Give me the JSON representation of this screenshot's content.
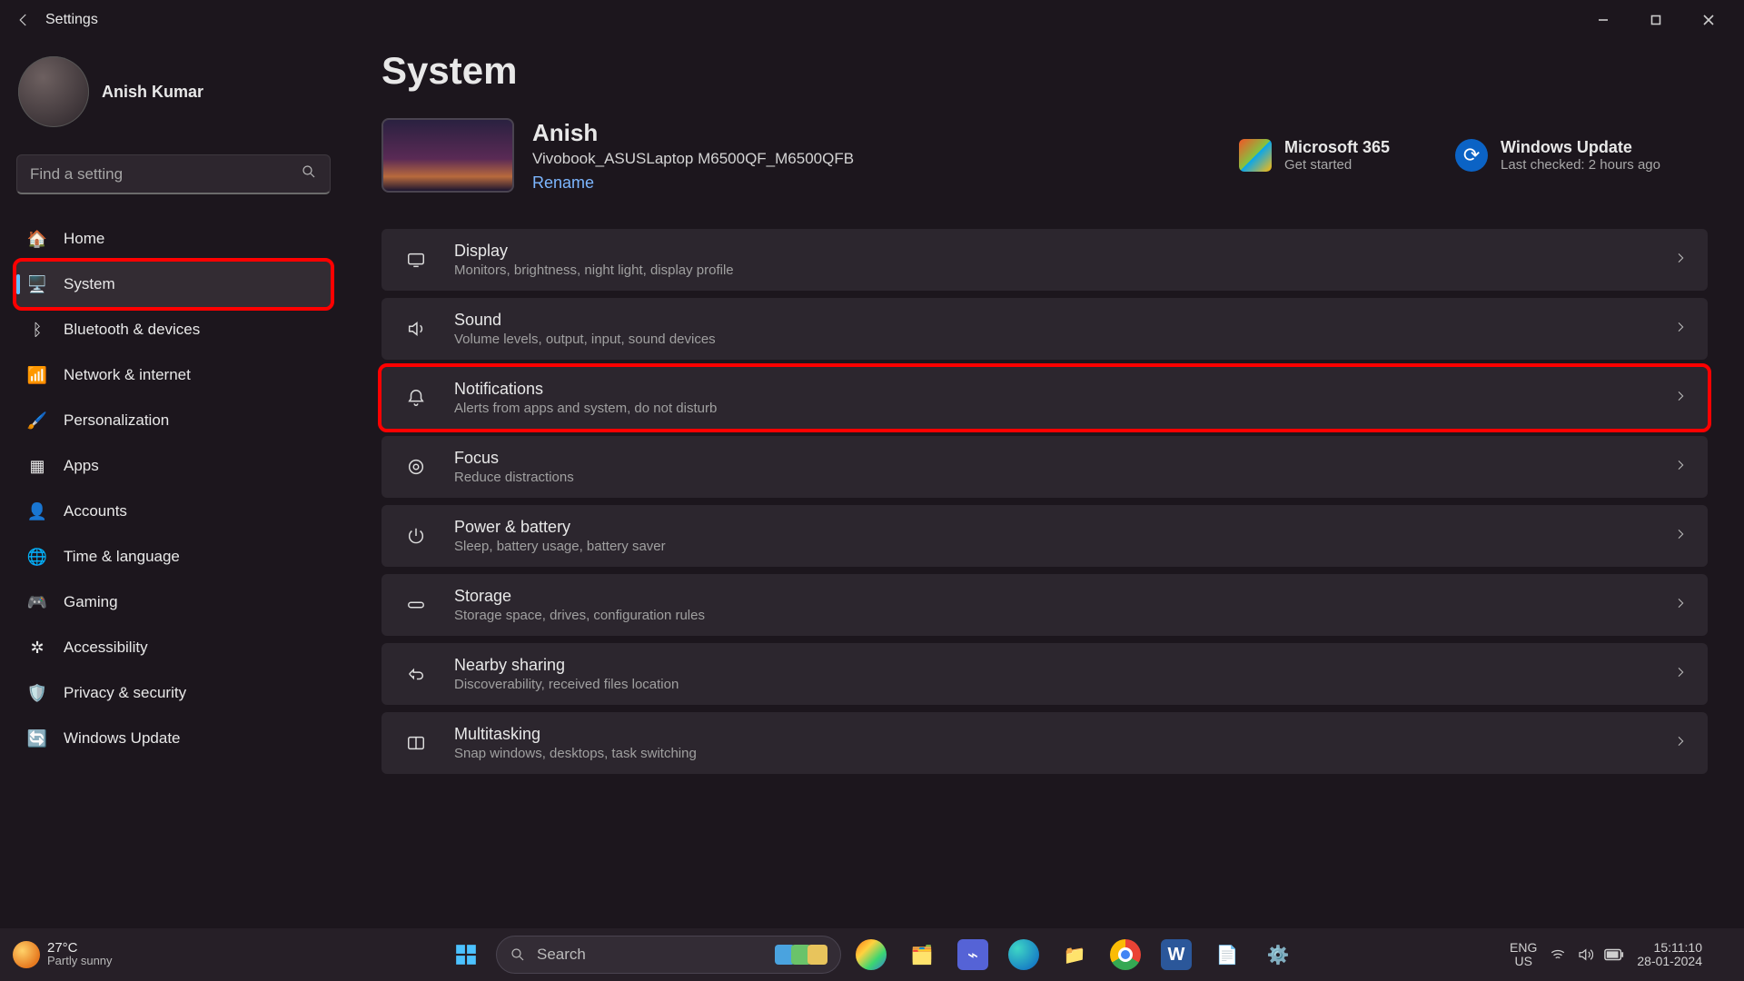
{
  "titlebar": {
    "app": "Settings"
  },
  "user": {
    "name": "Anish Kumar",
    "sub": ""
  },
  "search": {
    "placeholder": "Find a setting"
  },
  "nav": [
    {
      "icon": "🏠",
      "label": "Home"
    },
    {
      "icon": "🖥️",
      "label": "System"
    },
    {
      "icon": "ᛒ",
      "label": "Bluetooth & devices"
    },
    {
      "icon": "📶",
      "label": "Network & internet"
    },
    {
      "icon": "🖌️",
      "label": "Personalization"
    },
    {
      "icon": "▦",
      "label": "Apps"
    },
    {
      "icon": "👤",
      "label": "Accounts"
    },
    {
      "icon": "🌐",
      "label": "Time & language"
    },
    {
      "icon": "🎮",
      "label": "Gaming"
    },
    {
      "icon": "✲",
      "label": "Accessibility"
    },
    {
      "icon": "🛡️",
      "label": "Privacy & security"
    },
    {
      "icon": "🔄",
      "label": "Windows Update"
    }
  ],
  "page": {
    "title": "System"
  },
  "device": {
    "name": "Anish",
    "model": "Vivobook_ASUSLaptop M6500QF_M6500QFB",
    "rename": "Rename"
  },
  "promo": {
    "m365": {
      "title": "Microsoft 365",
      "sub": "Get started"
    },
    "wu": {
      "title": "Windows Update",
      "sub": "Last checked: 2 hours ago"
    }
  },
  "settings": [
    {
      "key": "display",
      "title": "Display",
      "desc": "Monitors, brightness, night light, display profile"
    },
    {
      "key": "sound",
      "title": "Sound",
      "desc": "Volume levels, output, input, sound devices"
    },
    {
      "key": "notifications",
      "title": "Notifications",
      "desc": "Alerts from apps and system, do not disturb"
    },
    {
      "key": "focus",
      "title": "Focus",
      "desc": "Reduce distractions"
    },
    {
      "key": "power",
      "title": "Power & battery",
      "desc": "Sleep, battery usage, battery saver"
    },
    {
      "key": "storage",
      "title": "Storage",
      "desc": "Storage space, drives, configuration rules"
    },
    {
      "key": "nearby",
      "title": "Nearby sharing",
      "desc": "Discoverability, received files location"
    },
    {
      "key": "multitask",
      "title": "Multitasking",
      "desc": "Snap windows, desktops, task switching"
    }
  ],
  "taskbar": {
    "weather": {
      "temp": "27°C",
      "desc": "Partly sunny"
    },
    "search": {
      "placeholder": "Search"
    },
    "lang": {
      "l1": "ENG",
      "l2": "US"
    },
    "clock": {
      "time": "15:11:10",
      "date": "28-01-2024"
    }
  }
}
